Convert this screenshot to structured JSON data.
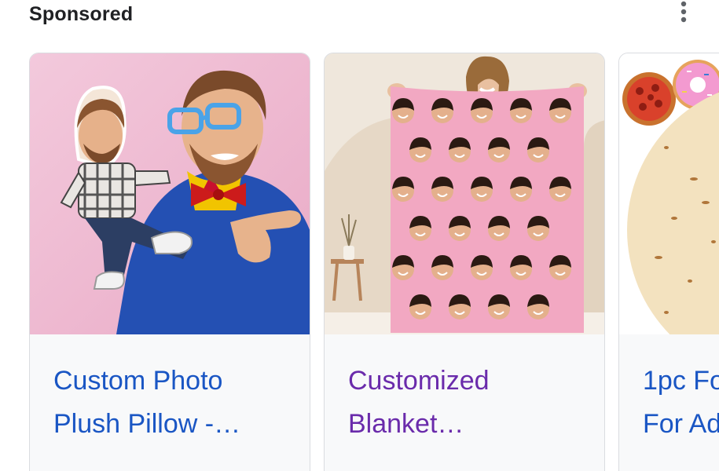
{
  "header": {
    "title": "Sponsored",
    "more_icon": "more-vert-icon"
  },
  "products": [
    {
      "title_line1": "Custom Photo",
      "title_line2": "Plush Pillow -…",
      "image_icon": "photo-plush-pillow-image",
      "link_color": "#1a56c4"
    },
    {
      "title_line1": "Customized",
      "title_line2": "Blanket…",
      "image_icon": "face-print-blanket-image",
      "link_color": "#6a2bab"
    },
    {
      "title_line1": "1pc Fo",
      "title_line2": "For Ad",
      "image_icon": "tortilla-blanket-image",
      "link_color": "#1a56c4"
    }
  ]
}
